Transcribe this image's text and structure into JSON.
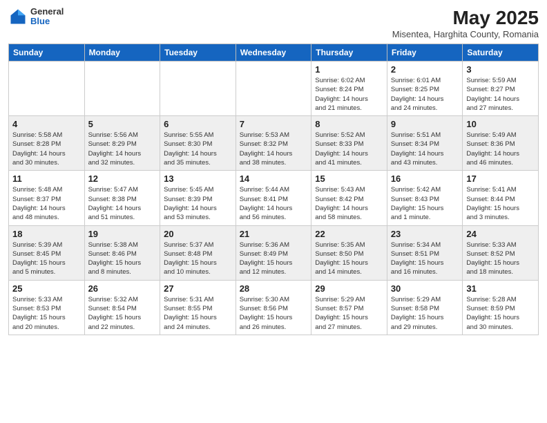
{
  "header": {
    "logo": {
      "general": "General",
      "blue": "Blue"
    },
    "title": "May 2025",
    "location": "Misentea, Harghita County, Romania"
  },
  "weekdays": [
    "Sunday",
    "Monday",
    "Tuesday",
    "Wednesday",
    "Thursday",
    "Friday",
    "Saturday"
  ],
  "weeks": [
    [
      {
        "num": "",
        "info": ""
      },
      {
        "num": "",
        "info": ""
      },
      {
        "num": "",
        "info": ""
      },
      {
        "num": "",
        "info": ""
      },
      {
        "num": "1",
        "info": "Sunrise: 6:02 AM\nSunset: 8:24 PM\nDaylight: 14 hours\nand 21 minutes."
      },
      {
        "num": "2",
        "info": "Sunrise: 6:01 AM\nSunset: 8:25 PM\nDaylight: 14 hours\nand 24 minutes."
      },
      {
        "num": "3",
        "info": "Sunrise: 5:59 AM\nSunset: 8:27 PM\nDaylight: 14 hours\nand 27 minutes."
      }
    ],
    [
      {
        "num": "4",
        "info": "Sunrise: 5:58 AM\nSunset: 8:28 PM\nDaylight: 14 hours\nand 30 minutes."
      },
      {
        "num": "5",
        "info": "Sunrise: 5:56 AM\nSunset: 8:29 PM\nDaylight: 14 hours\nand 32 minutes."
      },
      {
        "num": "6",
        "info": "Sunrise: 5:55 AM\nSunset: 8:30 PM\nDaylight: 14 hours\nand 35 minutes."
      },
      {
        "num": "7",
        "info": "Sunrise: 5:53 AM\nSunset: 8:32 PM\nDaylight: 14 hours\nand 38 minutes."
      },
      {
        "num": "8",
        "info": "Sunrise: 5:52 AM\nSunset: 8:33 PM\nDaylight: 14 hours\nand 41 minutes."
      },
      {
        "num": "9",
        "info": "Sunrise: 5:51 AM\nSunset: 8:34 PM\nDaylight: 14 hours\nand 43 minutes."
      },
      {
        "num": "10",
        "info": "Sunrise: 5:49 AM\nSunset: 8:36 PM\nDaylight: 14 hours\nand 46 minutes."
      }
    ],
    [
      {
        "num": "11",
        "info": "Sunrise: 5:48 AM\nSunset: 8:37 PM\nDaylight: 14 hours\nand 48 minutes."
      },
      {
        "num": "12",
        "info": "Sunrise: 5:47 AM\nSunset: 8:38 PM\nDaylight: 14 hours\nand 51 minutes."
      },
      {
        "num": "13",
        "info": "Sunrise: 5:45 AM\nSunset: 8:39 PM\nDaylight: 14 hours\nand 53 minutes."
      },
      {
        "num": "14",
        "info": "Sunrise: 5:44 AM\nSunset: 8:41 PM\nDaylight: 14 hours\nand 56 minutes."
      },
      {
        "num": "15",
        "info": "Sunrise: 5:43 AM\nSunset: 8:42 PM\nDaylight: 14 hours\nand 58 minutes."
      },
      {
        "num": "16",
        "info": "Sunrise: 5:42 AM\nSunset: 8:43 PM\nDaylight: 15 hours\nand 1 minute."
      },
      {
        "num": "17",
        "info": "Sunrise: 5:41 AM\nSunset: 8:44 PM\nDaylight: 15 hours\nand 3 minutes."
      }
    ],
    [
      {
        "num": "18",
        "info": "Sunrise: 5:39 AM\nSunset: 8:45 PM\nDaylight: 15 hours\nand 5 minutes."
      },
      {
        "num": "19",
        "info": "Sunrise: 5:38 AM\nSunset: 8:46 PM\nDaylight: 15 hours\nand 8 minutes."
      },
      {
        "num": "20",
        "info": "Sunrise: 5:37 AM\nSunset: 8:48 PM\nDaylight: 15 hours\nand 10 minutes."
      },
      {
        "num": "21",
        "info": "Sunrise: 5:36 AM\nSunset: 8:49 PM\nDaylight: 15 hours\nand 12 minutes."
      },
      {
        "num": "22",
        "info": "Sunrise: 5:35 AM\nSunset: 8:50 PM\nDaylight: 15 hours\nand 14 minutes."
      },
      {
        "num": "23",
        "info": "Sunrise: 5:34 AM\nSunset: 8:51 PM\nDaylight: 15 hours\nand 16 minutes."
      },
      {
        "num": "24",
        "info": "Sunrise: 5:33 AM\nSunset: 8:52 PM\nDaylight: 15 hours\nand 18 minutes."
      }
    ],
    [
      {
        "num": "25",
        "info": "Sunrise: 5:33 AM\nSunset: 8:53 PM\nDaylight: 15 hours\nand 20 minutes."
      },
      {
        "num": "26",
        "info": "Sunrise: 5:32 AM\nSunset: 8:54 PM\nDaylight: 15 hours\nand 22 minutes."
      },
      {
        "num": "27",
        "info": "Sunrise: 5:31 AM\nSunset: 8:55 PM\nDaylight: 15 hours\nand 24 minutes."
      },
      {
        "num": "28",
        "info": "Sunrise: 5:30 AM\nSunset: 8:56 PM\nDaylight: 15 hours\nand 26 minutes."
      },
      {
        "num": "29",
        "info": "Sunrise: 5:29 AM\nSunset: 8:57 PM\nDaylight: 15 hours\nand 27 minutes."
      },
      {
        "num": "30",
        "info": "Sunrise: 5:29 AM\nSunset: 8:58 PM\nDaylight: 15 hours\nand 29 minutes."
      },
      {
        "num": "31",
        "info": "Sunrise: 5:28 AM\nSunset: 8:59 PM\nDaylight: 15 hours\nand 30 minutes."
      }
    ]
  ]
}
